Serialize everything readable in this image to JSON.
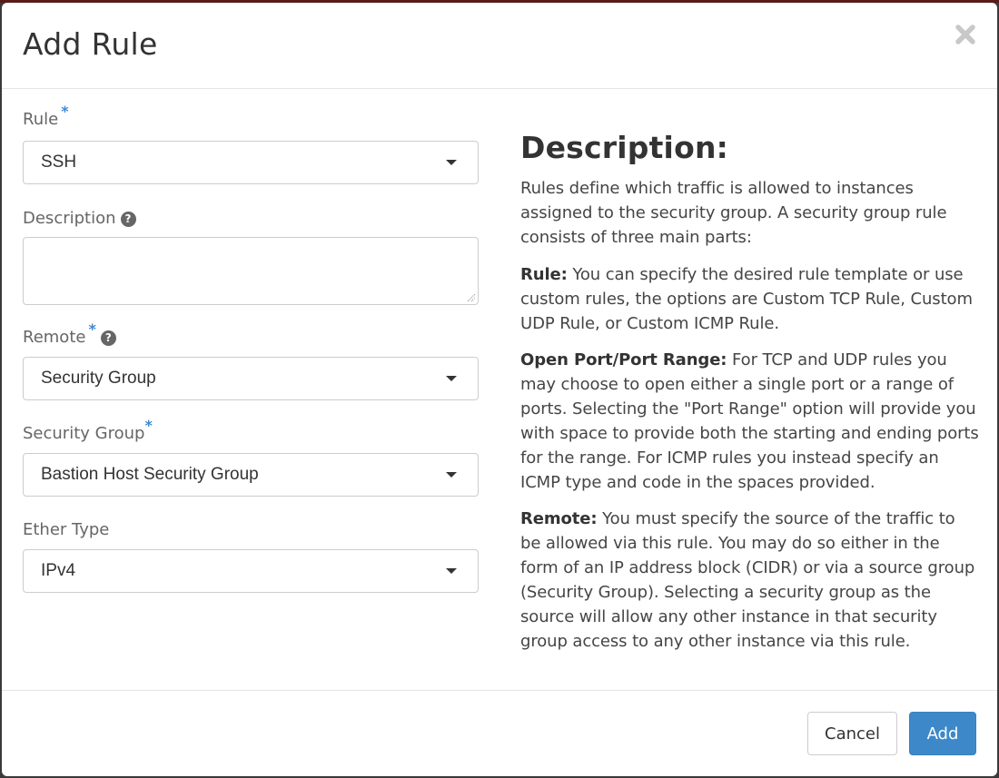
{
  "modal": {
    "title": "Add Rule",
    "close_icon": "close-icon"
  },
  "form": {
    "rule": {
      "label": "Rule",
      "required_mark": "*",
      "value": "SSH"
    },
    "description": {
      "label": "Description",
      "help_icon": "?",
      "value": "",
      "placeholder": ""
    },
    "remote": {
      "label": "Remote",
      "required_mark": "*",
      "help_icon": "?",
      "value": "Security Group"
    },
    "security_group": {
      "label": "Security Group",
      "required_mark": "*",
      "value": "Bastion Host Security Group"
    },
    "ether_type": {
      "label": "Ether Type",
      "value": "IPv4"
    }
  },
  "help": {
    "title": "Description:",
    "intro": "Rules define which traffic is allowed to instances assigned to the security group. A security group rule consists of three main parts:",
    "sections": [
      {
        "term": "Rule:",
        "text": " You can specify the desired rule template or use custom rules, the options are Custom TCP Rule, Custom UDP Rule, or Custom ICMP Rule."
      },
      {
        "term": "Open Port/Port Range:",
        "text": " For TCP and UDP rules you may choose to open either a single port or a range of ports. Selecting the \"Port Range\" option will provide you with space to provide both the starting and ending ports for the range. For ICMP rules you instead specify an ICMP type and code in the spaces provided."
      },
      {
        "term": "Remote:",
        "text": " You must specify the source of the traffic to be allowed via this rule. You may do so either in the form of an IP address block (CIDR) or via a source group (Security Group). Selecting a security group as the source will allow any other instance in that security group access to any other instance via this rule."
      }
    ]
  },
  "footer": {
    "cancel_label": "Cancel",
    "add_label": "Add"
  },
  "colors": {
    "primary": "#3d88c9",
    "required": "#3d8ad0"
  }
}
